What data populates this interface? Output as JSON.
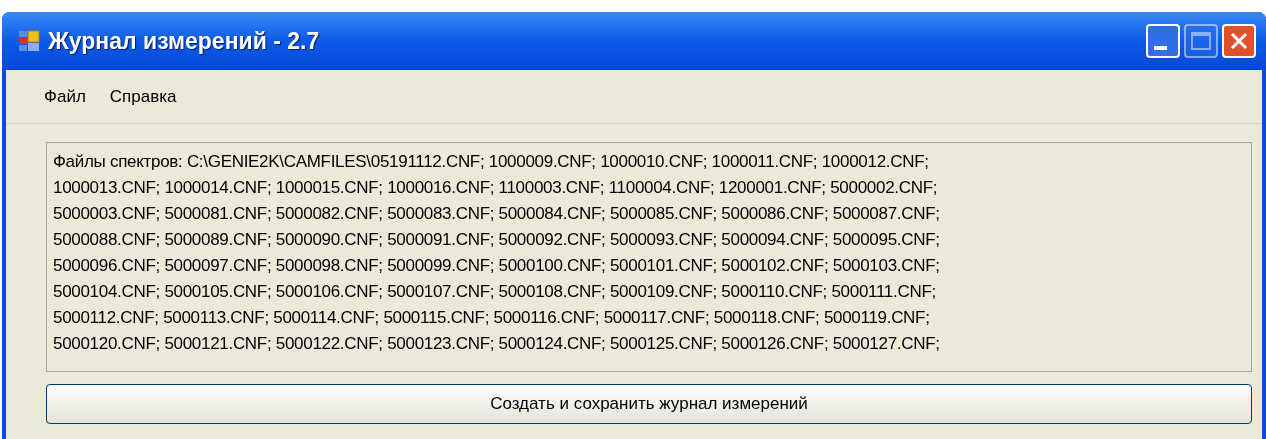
{
  "window": {
    "title": "Журнал измерений - 2.7",
    "controls": [
      {
        "kind": "minimize",
        "disabled": false
      },
      {
        "kind": "maximize",
        "disabled": true
      },
      {
        "kind": "close",
        "disabled": false
      }
    ]
  },
  "menu": [
    "Файл",
    "Справка"
  ],
  "files_box": {
    "lines": [
      "Файлы спектров: C:\\GENIE2K\\CAMFILES\\05191112.CNF; 1000009.CNF; 1000010.CNF; 1000011.CNF; 1000012.CNF;",
      "1000013.CNF; 1000014.CNF; 1000015.CNF; 1000016.CNF; 1100003.CNF; 1100004.CNF; 1200001.CNF; 5000002.CNF;",
      "5000003.CNF; 5000081.CNF; 5000082.CNF; 5000083.CNF; 5000084.CNF; 5000085.CNF; 5000086.CNF; 5000087.CNF;",
      "5000088.CNF; 5000089.CNF; 5000090.CNF; 5000091.CNF; 5000092.CNF; 5000093.CNF; 5000094.CNF; 5000095.CNF;",
      "5000096.CNF; 5000097.CNF; 5000098.CNF; 5000099.CNF; 5000100.CNF; 5000101.CNF; 5000102.CNF; 5000103.CNF;",
      "5000104.CNF; 5000105.CNF; 5000106.CNF; 5000107.CNF; 5000108.CNF; 5000109.CNF; 5000110.CNF; 5000111.CNF;",
      "5000112.CNF; 5000113.CNF; 5000114.CNF; 5000115.CNF; 5000116.CNF; 5000117.CNF; 5000118.CNF; 5000119.CNF;",
      "5000120.CNF; 5000121.CNF; 5000122.CNF; 5000123.CNF; 5000124.CNF; 5000125.CNF; 5000126.CNF; 5000127.CNF;"
    ]
  },
  "button": "Создать и сохранить журнал измерений"
}
